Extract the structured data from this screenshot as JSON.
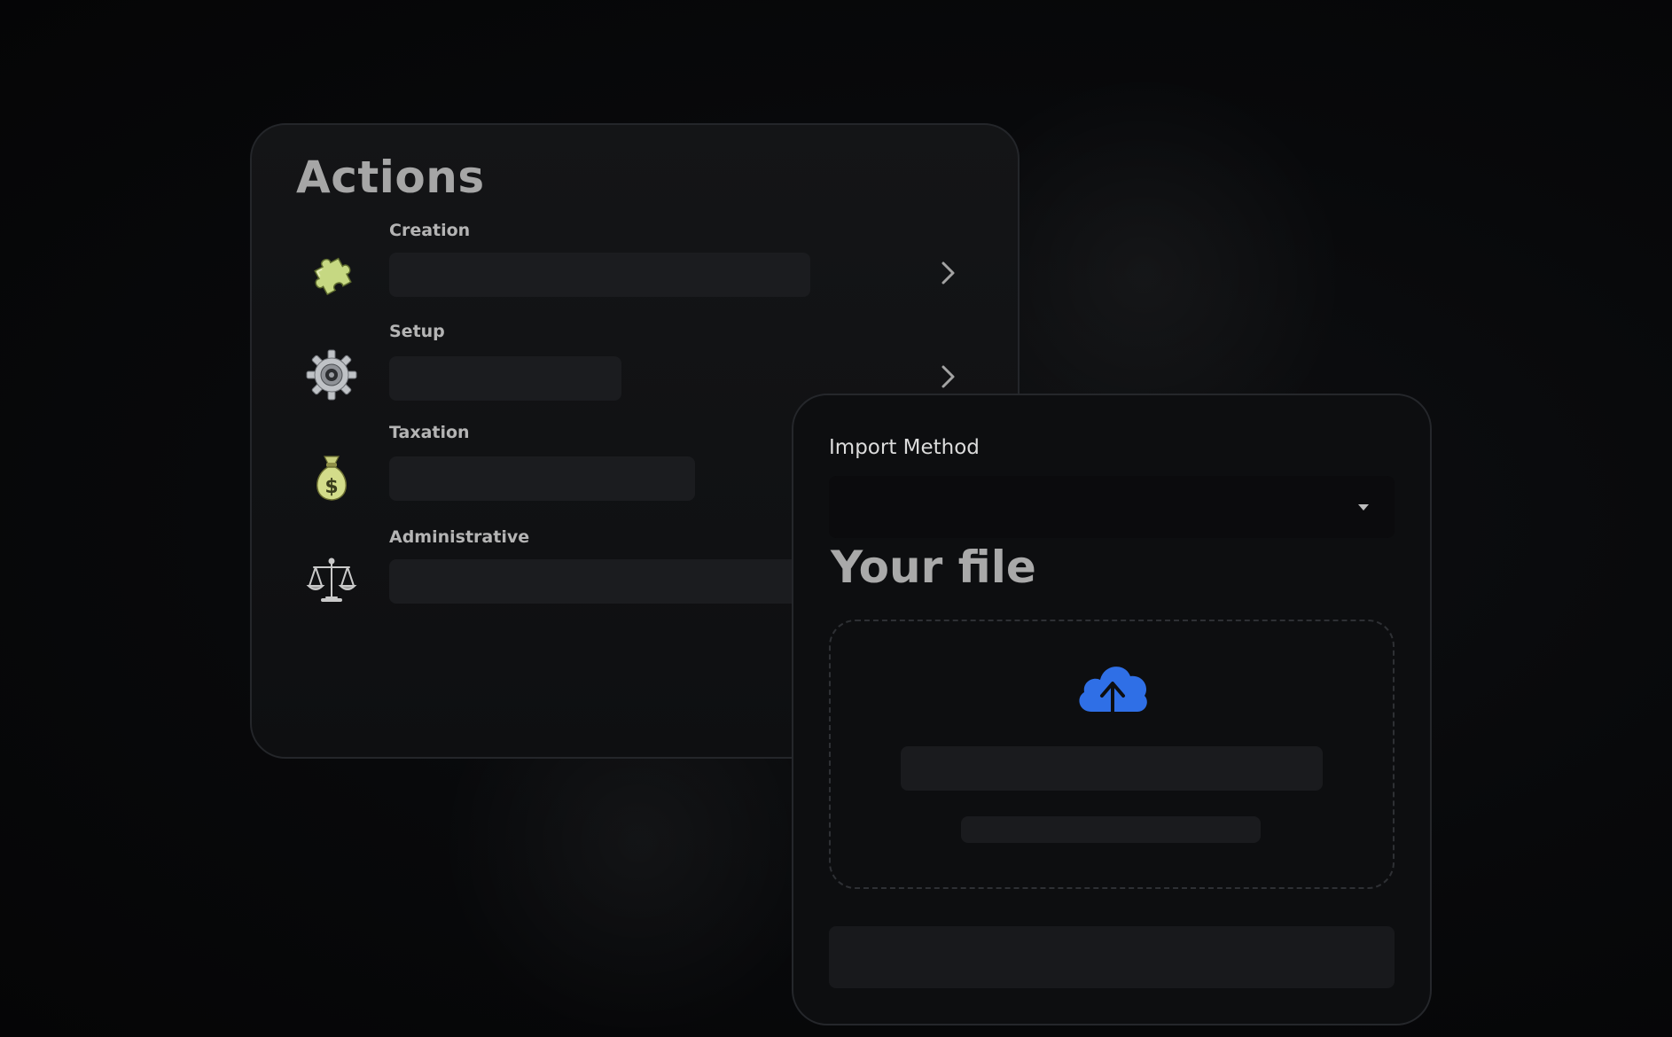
{
  "actions": {
    "title": "Actions",
    "items": [
      {
        "label": "Creation",
        "icon": "puzzle-piece-icon",
        "has_chevron": true
      },
      {
        "label": "Setup",
        "icon": "gear-icon",
        "has_chevron": true
      },
      {
        "label": "Taxation",
        "icon": "money-bag-icon",
        "has_chevron": false
      },
      {
        "label": "Administrative",
        "icon": "balance-scale-icon",
        "has_chevron": false
      }
    ]
  },
  "import": {
    "method_label": "Import Method",
    "method_value": "",
    "file_title": "Your file",
    "upload_icon": "cloud-upload-icon"
  },
  "colors": {
    "accent": "#2f6fe6",
    "background": "#08090b",
    "card": "#121315",
    "placeholder": "#1b1c1f"
  }
}
